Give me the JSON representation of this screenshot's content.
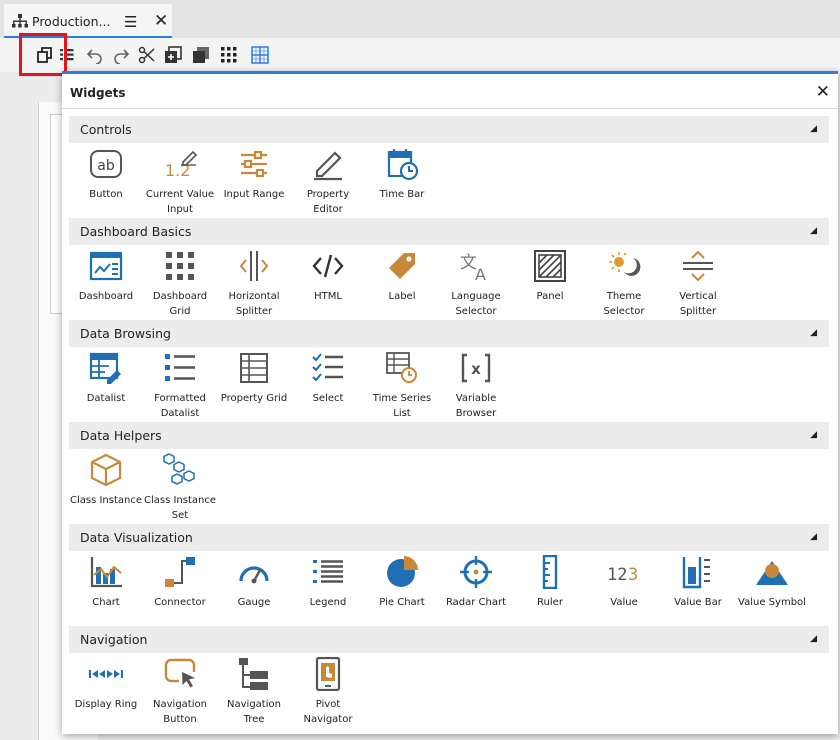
{
  "tab": {
    "title": "Production..."
  },
  "dialog": {
    "title": "Widgets"
  },
  "colors": {
    "blue": "#1f6fb2",
    "orange": "#c98839",
    "gray": "#555555",
    "accent": "#2a7de1",
    "highlight": "#e8141c"
  },
  "sections": [
    {
      "title": "Controls",
      "items": [
        {
          "label": "Button",
          "icon": "button-icon"
        },
        {
          "label": "Current Value Input",
          "icon": "current-value-input-icon"
        },
        {
          "label": "Input Range",
          "icon": "input-range-icon"
        },
        {
          "label": "Property Editor",
          "icon": "property-editor-icon"
        },
        {
          "label": "Time Bar",
          "icon": "time-bar-icon"
        }
      ]
    },
    {
      "title": "Dashboard Basics",
      "items": [
        {
          "label": "Dashboard",
          "icon": "dashboard-icon"
        },
        {
          "label": "Dashboard Grid",
          "icon": "dashboard-grid-icon"
        },
        {
          "label": "Horizontal Splitter",
          "icon": "horizontal-splitter-icon"
        },
        {
          "label": "HTML",
          "icon": "html-icon"
        },
        {
          "label": "Label",
          "icon": "label-icon"
        },
        {
          "label": "Language Selector",
          "icon": "language-selector-icon"
        },
        {
          "label": "Panel",
          "icon": "panel-icon"
        },
        {
          "label": "Theme Selector",
          "icon": "theme-selector-icon"
        },
        {
          "label": "Vertical Splitter",
          "icon": "vertical-splitter-icon"
        }
      ]
    },
    {
      "title": "Data Browsing",
      "items": [
        {
          "label": "Datalist",
          "icon": "datalist-icon"
        },
        {
          "label": "Formatted Datalist",
          "icon": "formatted-datalist-icon"
        },
        {
          "label": "Property Grid",
          "icon": "property-grid-icon"
        },
        {
          "label": "Select",
          "icon": "select-icon"
        },
        {
          "label": "Time Series List",
          "icon": "time-series-list-icon"
        },
        {
          "label": "Variable Browser",
          "icon": "variable-browser-icon"
        }
      ]
    },
    {
      "title": "Data Helpers",
      "items": [
        {
          "label": "Class Instance",
          "icon": "class-instance-icon"
        },
        {
          "label": "Class Instance Set",
          "icon": "class-instance-set-icon"
        }
      ]
    },
    {
      "title": "Data Visualization",
      "items": [
        {
          "label": "Chart",
          "icon": "chart-icon"
        },
        {
          "label": "Connector",
          "icon": "connector-icon"
        },
        {
          "label": "Gauge",
          "icon": "gauge-icon"
        },
        {
          "label": "Legend",
          "icon": "legend-icon"
        },
        {
          "label": "Pie Chart",
          "icon": "pie-chart-icon"
        },
        {
          "label": "Radar Chart",
          "icon": "radar-chart-icon"
        },
        {
          "label": "Ruler",
          "icon": "ruler-icon"
        },
        {
          "label": "Value",
          "icon": "value-icon"
        },
        {
          "label": "Value Bar",
          "icon": "value-bar-icon"
        },
        {
          "label": "Value Symbol",
          "icon": "value-symbol-icon"
        }
      ]
    },
    {
      "title": "Navigation",
      "items": [
        {
          "label": "Display Ring",
          "icon": "display-ring-icon"
        },
        {
          "label": "Navigation Button",
          "icon": "navigation-button-icon"
        },
        {
          "label": "Navigation Tree",
          "icon": "navigation-tree-icon"
        },
        {
          "label": "Pivot Navigator",
          "icon": "pivot-navigator-icon"
        }
      ]
    }
  ]
}
